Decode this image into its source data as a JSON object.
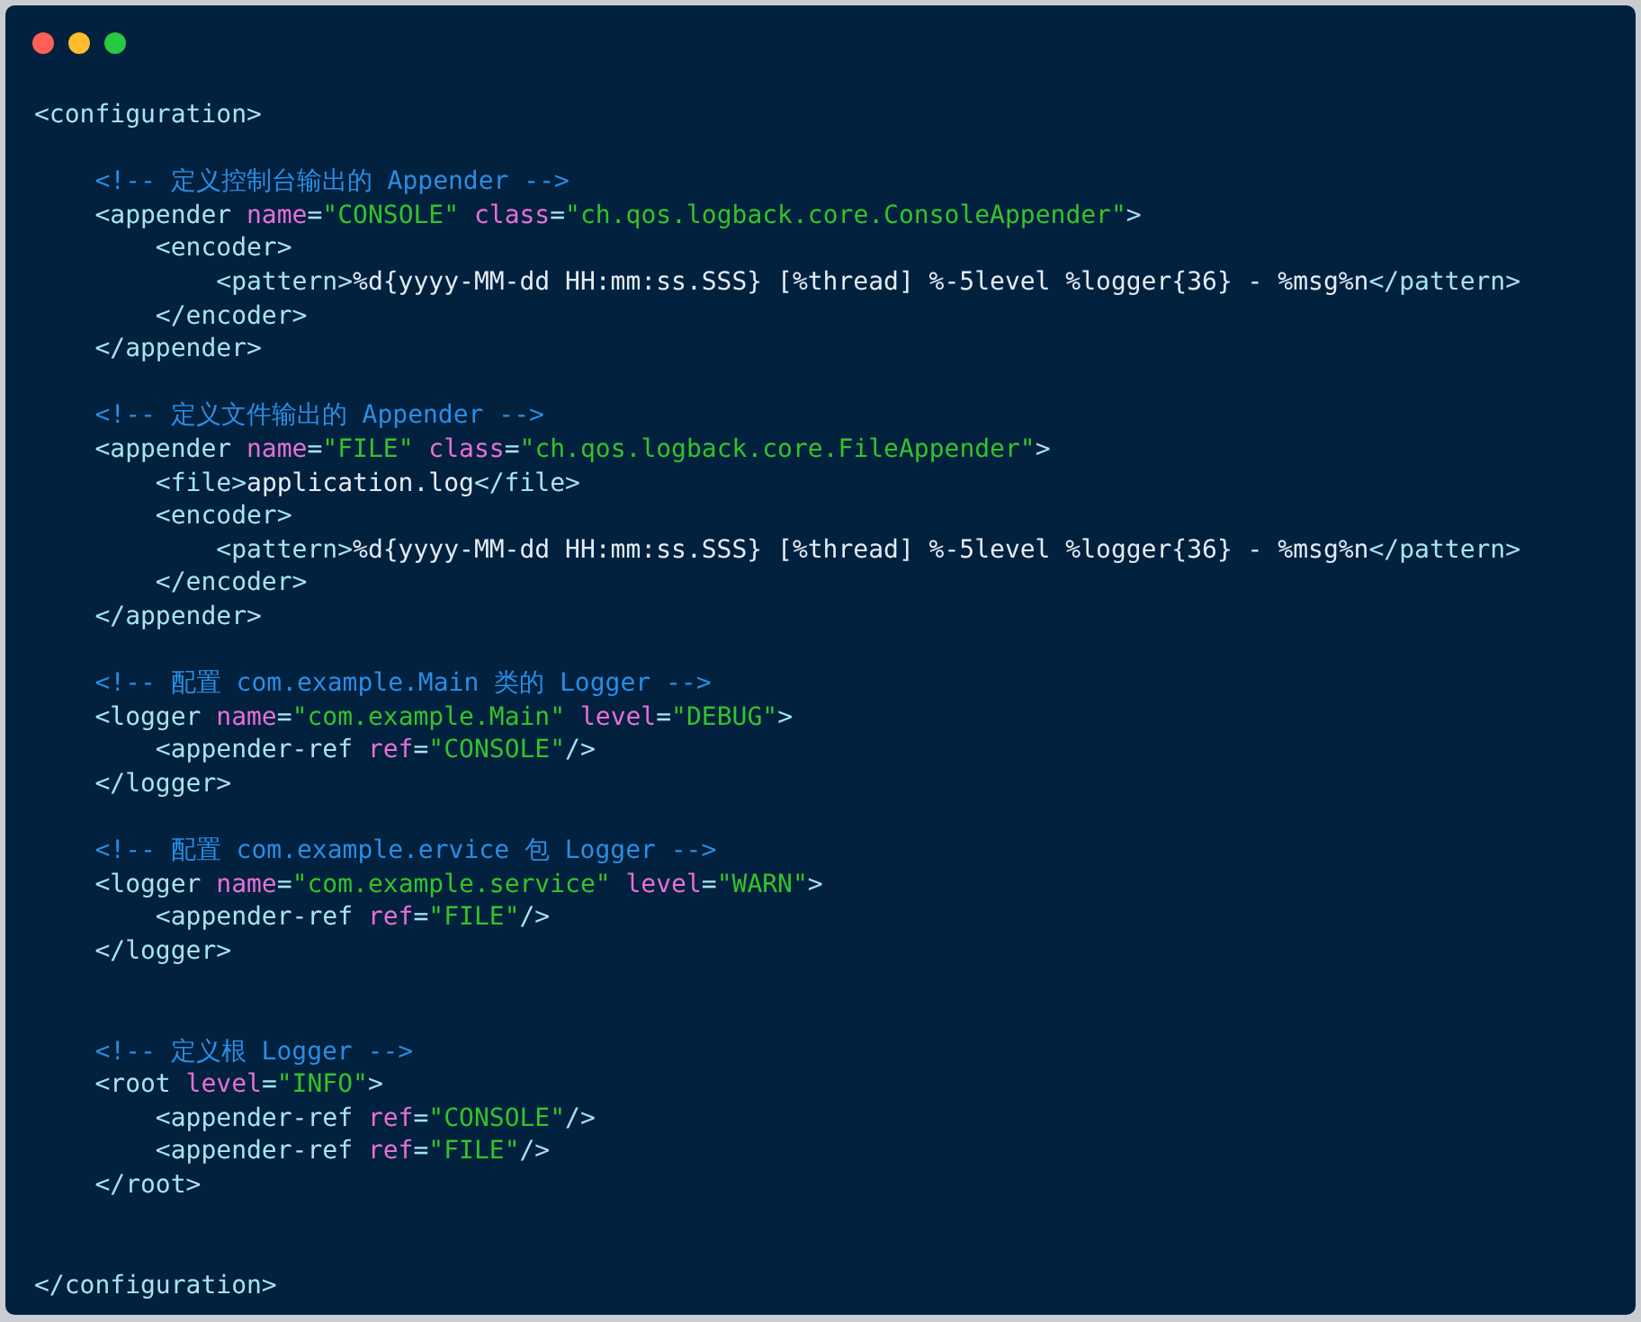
{
  "window": {
    "controls": [
      {
        "kind": "close"
      },
      {
        "kind": "minimize"
      },
      {
        "kind": "zoom"
      }
    ]
  },
  "code_lines": [
    {
      "tokens": [
        {
          "kind": "tag",
          "text": "<configuration>"
        }
      ]
    },
    {
      "kind": "blank"
    },
    {
      "tokens": [
        {
          "kind": "comment",
          "text": "    <!-- 定义控制台输出的 Appender -->"
        }
      ]
    },
    {
      "tokens": [
        {
          "kind": "tag",
          "text": "    <appender"
        },
        {
          "kind": "attr",
          "text": " name"
        },
        {
          "kind": "tag",
          "text": "="
        },
        {
          "kind": "value",
          "text": "\"CONSOLE\""
        },
        {
          "kind": "attr",
          "text": " class"
        },
        {
          "kind": "tag",
          "text": "="
        },
        {
          "kind": "value",
          "text": "\"ch.qos.logback.core.ConsoleAppender\""
        },
        {
          "kind": "tag",
          "text": ">"
        }
      ]
    },
    {
      "tokens": [
        {
          "kind": "tag",
          "text": "        <encoder>"
        }
      ]
    },
    {
      "tokens": [
        {
          "kind": "tag",
          "text": "            <pattern>"
        },
        {
          "kind": "text",
          "text": "%d{yyyy-MM-dd HH:mm:ss.SSS} [%thread] %-5level %logger{36} - %msg%n"
        },
        {
          "kind": "tag",
          "text": "</pattern>"
        }
      ]
    },
    {
      "tokens": [
        {
          "kind": "tag",
          "text": "        </encoder>"
        }
      ]
    },
    {
      "tokens": [
        {
          "kind": "tag",
          "text": "    </appender>"
        }
      ]
    },
    {
      "kind": "blank"
    },
    {
      "tokens": [
        {
          "kind": "comment",
          "text": "    <!-- 定义文件输出的 Appender -->"
        }
      ]
    },
    {
      "tokens": [
        {
          "kind": "tag",
          "text": "    <appender"
        },
        {
          "kind": "attr",
          "text": " name"
        },
        {
          "kind": "tag",
          "text": "="
        },
        {
          "kind": "value",
          "text": "\"FILE\""
        },
        {
          "kind": "attr",
          "text": " class"
        },
        {
          "kind": "tag",
          "text": "="
        },
        {
          "kind": "value",
          "text": "\"ch.qos.logback.core.FileAppender\""
        },
        {
          "kind": "tag",
          "text": ">"
        }
      ]
    },
    {
      "tokens": [
        {
          "kind": "tag",
          "text": "        <file>"
        },
        {
          "kind": "text",
          "text": "application.log"
        },
        {
          "kind": "tag",
          "text": "</file>"
        }
      ]
    },
    {
      "tokens": [
        {
          "kind": "tag",
          "text": "        <encoder>"
        }
      ]
    },
    {
      "tokens": [
        {
          "kind": "tag",
          "text": "            <pattern>"
        },
        {
          "kind": "text",
          "text": "%d{yyyy-MM-dd HH:mm:ss.SSS} [%thread] %-5level %logger{36} - %msg%n"
        },
        {
          "kind": "tag",
          "text": "</pattern>"
        }
      ]
    },
    {
      "tokens": [
        {
          "kind": "tag",
          "text": "        </encoder>"
        }
      ]
    },
    {
      "tokens": [
        {
          "kind": "tag",
          "text": "    </appender>"
        }
      ]
    },
    {
      "kind": "blank"
    },
    {
      "tokens": [
        {
          "kind": "comment",
          "text": "    <!-- 配置 com.example.Main 类的 Logger -->"
        }
      ]
    },
    {
      "tokens": [
        {
          "kind": "tag",
          "text": "    <logger"
        },
        {
          "kind": "attr",
          "text": " name"
        },
        {
          "kind": "tag",
          "text": "="
        },
        {
          "kind": "value",
          "text": "\"com.example.Main\""
        },
        {
          "kind": "attr",
          "text": " level"
        },
        {
          "kind": "tag",
          "text": "="
        },
        {
          "kind": "value",
          "text": "\"DEBUG\""
        },
        {
          "kind": "tag",
          "text": ">"
        }
      ]
    },
    {
      "tokens": [
        {
          "kind": "tag",
          "text": "        <appender-ref"
        },
        {
          "kind": "attr",
          "text": " ref"
        },
        {
          "kind": "tag",
          "text": "="
        },
        {
          "kind": "value",
          "text": "\"CONSOLE\""
        },
        {
          "kind": "tag",
          "text": "/>"
        }
      ]
    },
    {
      "tokens": [
        {
          "kind": "tag",
          "text": "    </logger>"
        }
      ]
    },
    {
      "kind": "blank"
    },
    {
      "tokens": [
        {
          "kind": "comment",
          "text": "    <!-- 配置 com.example.ervice 包 Logger -->"
        }
      ]
    },
    {
      "tokens": [
        {
          "kind": "tag",
          "text": "    <logger"
        },
        {
          "kind": "attr",
          "text": " name"
        },
        {
          "kind": "tag",
          "text": "="
        },
        {
          "kind": "value",
          "text": "\"com.example.service\""
        },
        {
          "kind": "attr",
          "text": " level"
        },
        {
          "kind": "tag",
          "text": "="
        },
        {
          "kind": "value",
          "text": "\"WARN\""
        },
        {
          "kind": "tag",
          "text": ">"
        }
      ]
    },
    {
      "tokens": [
        {
          "kind": "tag",
          "text": "        <appender-ref"
        },
        {
          "kind": "attr",
          "text": " ref"
        },
        {
          "kind": "tag",
          "text": "="
        },
        {
          "kind": "value",
          "text": "\"FILE\""
        },
        {
          "kind": "tag",
          "text": "/>"
        }
      ]
    },
    {
      "tokens": [
        {
          "kind": "tag",
          "text": "    </logger>"
        }
      ]
    },
    {
      "kind": "blank"
    },
    {
      "kind": "blank"
    },
    {
      "tokens": [
        {
          "kind": "comment",
          "text": "    <!-- 定义根 Logger -->"
        }
      ]
    },
    {
      "tokens": [
        {
          "kind": "tag",
          "text": "    <root"
        },
        {
          "kind": "attr",
          "text": " level"
        },
        {
          "kind": "tag",
          "text": "="
        },
        {
          "kind": "value",
          "text": "\"INFO\""
        },
        {
          "kind": "tag",
          "text": ">"
        }
      ]
    },
    {
      "tokens": [
        {
          "kind": "tag",
          "text": "        <appender-ref"
        },
        {
          "kind": "attr",
          "text": " ref"
        },
        {
          "kind": "tag",
          "text": "="
        },
        {
          "kind": "value",
          "text": "\"CONSOLE\""
        },
        {
          "kind": "tag",
          "text": "/>"
        }
      ]
    },
    {
      "tokens": [
        {
          "kind": "tag",
          "text": "        <appender-ref"
        },
        {
          "kind": "attr",
          "text": " ref"
        },
        {
          "kind": "tag",
          "text": "="
        },
        {
          "kind": "value",
          "text": "\"FILE\""
        },
        {
          "kind": "tag",
          "text": "/>"
        }
      ]
    },
    {
      "tokens": [
        {
          "kind": "tag",
          "text": "    </root>"
        }
      ]
    },
    {
      "kind": "blank"
    },
    {
      "kind": "blank"
    },
    {
      "tokens": [
        {
          "kind": "tag",
          "text": "</configuration>"
        }
      ]
    }
  ]
}
